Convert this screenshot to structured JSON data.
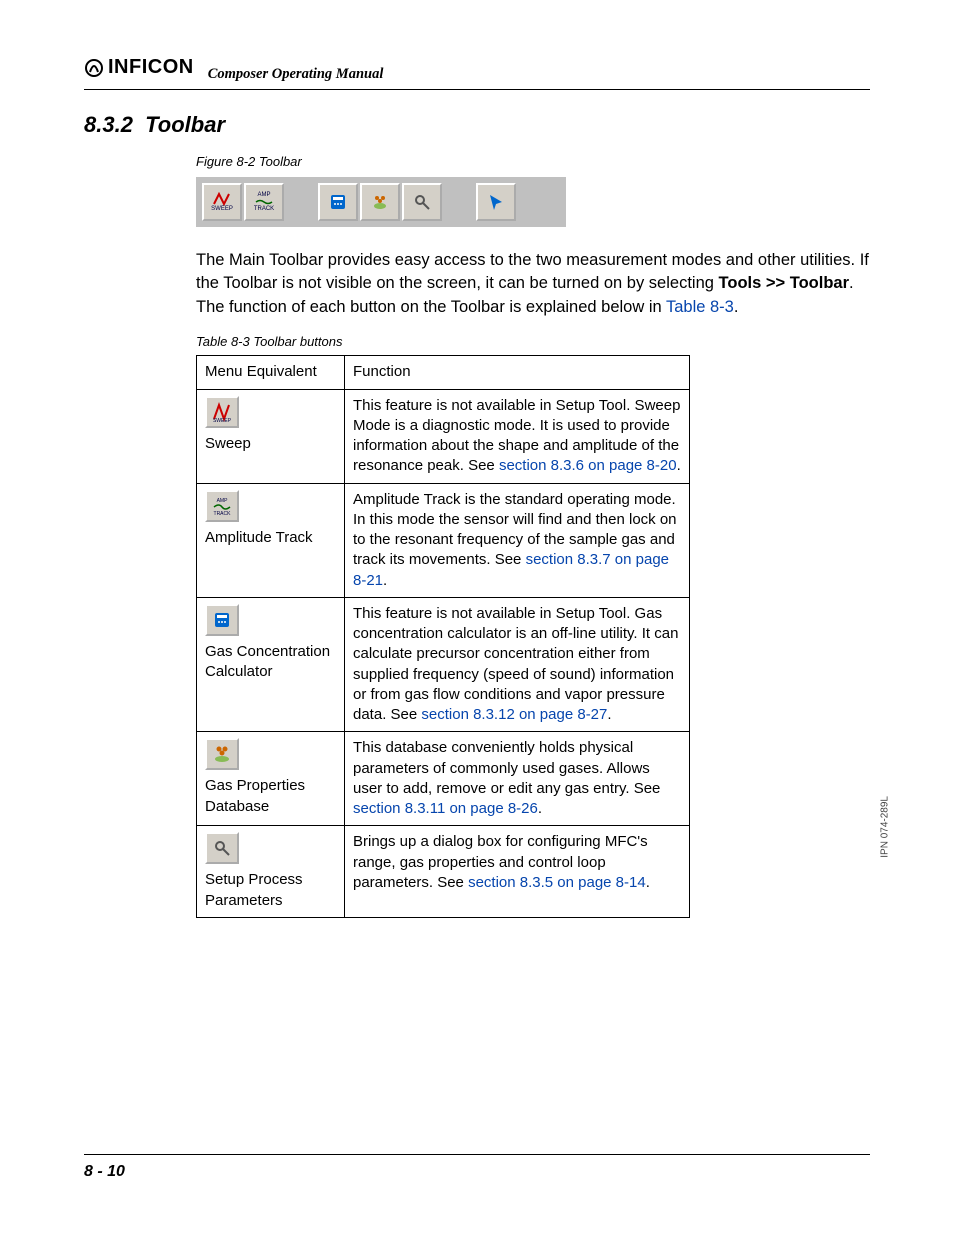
{
  "header": {
    "brand": "INFICON",
    "doc_title": "Composer Operating Manual"
  },
  "section": {
    "number": "8.3.2",
    "title": "Toolbar"
  },
  "figure": {
    "caption": "Figure 8-2  Toolbar",
    "buttons": [
      "SWEEP",
      "AMP TRACK",
      "calc-icon",
      "gas-db-icon",
      "wrench-icon",
      "pointer-icon"
    ]
  },
  "paragraph": {
    "p1a": "The Main Toolbar provides easy access to the two measurement modes and other utilities. If the Toolbar is not visible on the screen, it can be turned on by selecting ",
    "p1b_bold": "Tools >> Toolbar",
    "p1c": ". The function of each button on the Toolbar is explained below in ",
    "p1_link": "Table 8-3",
    "p1d": "."
  },
  "table": {
    "caption": "Table 8-3  Toolbar buttons",
    "headers": {
      "col1": "Menu Equivalent",
      "col2": "Function"
    },
    "rows": [
      {
        "label": "Sweep",
        "icon": "sweep-icon",
        "func_a": "This feature is not available in Setup Tool. Sweep Mode is a diagnostic mode. It is used to provide information about the shape and amplitude of the resonance peak. See ",
        "func_link": "section 8.3.6 on page 8-20",
        "func_b": "."
      },
      {
        "label": "Amplitude Track",
        "icon": "amp-track-icon",
        "func_a": "Amplitude Track is the standard operating mode. In this mode the sensor will find and then lock on to the resonant frequency of the sample gas and track its movements. See ",
        "func_link": "section 8.3.7 on page 8-21",
        "func_b": "."
      },
      {
        "label": "Gas Concentration Calculator",
        "icon": "calculator-icon",
        "func_a": "This feature is not available in Setup Tool. Gas concentration calculator is an off-line utility. It can calculate precursor concentration either from supplied frequency (speed of sound) information or from gas flow conditions and vapor pressure data. See ",
        "func_link": "section 8.3.12 on page 8-27",
        "func_b": "."
      },
      {
        "label": "Gas Properties Database",
        "icon": "gas-database-icon",
        "func_a": "This database conveniently holds physical parameters of commonly used gases. Allows user to add, remove or edit any gas entry. See ",
        "func_link": "section 8.3.11 on page 8-26",
        "func_b": "."
      },
      {
        "label": "Setup Process Parameters",
        "icon": "wrench-icon",
        "func_a": "Brings up a dialog box for configuring MFC's range, gas properties and control loop parameters. See ",
        "func_link": "section 8.3.5 on page 8-14",
        "func_b": "."
      }
    ]
  },
  "side_label": "IPN 074-289L",
  "footer": {
    "page": "8 - 10"
  }
}
